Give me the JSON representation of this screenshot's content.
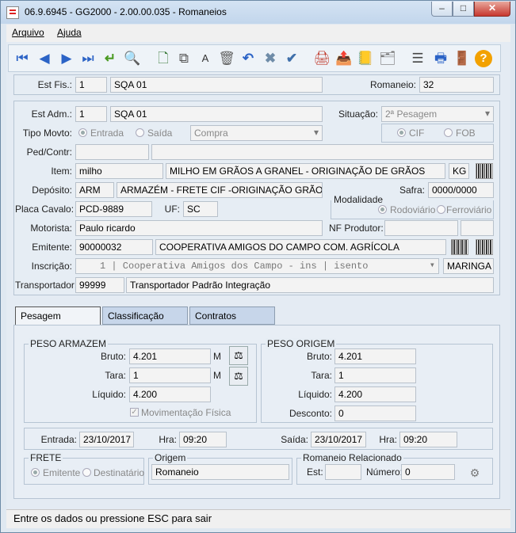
{
  "window": {
    "title": "06.9.6945 - GG2000 - 2.00.00.035 - Romaneios",
    "min": "–",
    "max": "□",
    "close": "✕"
  },
  "menu": {
    "arquivo": "Arquivo",
    "ajuda": "Ajuda"
  },
  "toolbar": {
    "icons": [
      "first-icon",
      "previous-icon",
      "next-icon",
      "last-icon",
      "confirm-icon",
      "search-icon",
      "new-icon",
      "copy-icon",
      "text-icon",
      "delete-icon",
      "undo-icon",
      "cancel-icon",
      "check-icon",
      "print-user-icon",
      "export-icon",
      "book-icon",
      "folder-x-icon",
      "tree-icon",
      "printer-icon",
      "exit-icon",
      "help-icon"
    ]
  },
  "header": {
    "est_fis_label": "Est Fis.:",
    "est_fis_code": "1",
    "est_fis_name": "SQA 01",
    "romaneio_label": "Romaneio:",
    "romaneio_value": "32"
  },
  "form": {
    "est_adm_label": "Est Adm.:",
    "est_adm_code": "1",
    "est_adm_name": "SQA 01",
    "situacao_label": "Situação:",
    "situacao_value": "2ª Pesagem",
    "tipo_movto_label": "Tipo Movto:",
    "entrada": "Entrada",
    "saida": "Saída",
    "tipo_value": "Compra",
    "cif": "CIF",
    "fob": "FOB",
    "ped_contr_label": "Ped/Contr:",
    "item_label": "Item:",
    "item_code": "milho",
    "item_desc": "MILHO EM GRÃOS A GRANEL - ORIGINAÇÃO DE GRÃOS",
    "item_unit": "KG",
    "deposito_label": "Depósito:",
    "deposito_code": "ARM",
    "deposito_desc": "ARMAZÉM - FRETE CIF -ORIGINAÇÃO GRÃOS",
    "safra_label": "Safra:",
    "safra_value": "0000/0000",
    "modalidade_label": "Modalidade",
    "rodoviario": "Rodoviário",
    "ferroviario": "Ferroviário",
    "placa_label": "Placa Cavalo:",
    "placa_value": "PCD-9889",
    "uf_label": "UF:",
    "uf_value": "SC",
    "motorista_label": "Motorista:",
    "motorista_value": "Paulo ricardo",
    "nf_produtor_label": "NF Produtor:",
    "emitente_label": "Emitente:",
    "emitente_code": "90000032",
    "emitente_name": "COOPERATIVA AMIGOS DO CAMPO COM. AGRÍCOLA",
    "inscricao_label": "Inscrição:",
    "inscricao_value": "1 | Cooperativa Amigos dos Campo - ins | isento",
    "inscricao_city": "MARINGA",
    "transportador_label": "Transportador:",
    "transportador_code": "99999",
    "transportador_name": "Transportador Padrão Integração"
  },
  "tabs": [
    "Pesagem",
    "Classificação",
    "Contratos"
  ],
  "pesagem": {
    "peso_armazem_caption": "PESO ARMAZEM",
    "bruto_label": "Bruto:",
    "bruto_value": "4.201",
    "bruto_unit": "M",
    "tara_label": "Tara:",
    "tara_value": "1",
    "tara_unit": "M",
    "liquido_label": "Líquido:",
    "liquido_value": "4.200",
    "movimentacao": "Movimentação Física",
    "peso_origem_caption": "PESO ORIGEM",
    "o_bruto_label": "Bruto:",
    "o_bruto_value": "4.201",
    "o_tara_label": "Tara:",
    "o_tara_value": "1",
    "o_liquido_label": "Líquido:",
    "o_liquido_value": "4.200",
    "desconto_label": "Desconto:",
    "desconto_value": "0"
  },
  "datas": {
    "entrada_label": "Entrada:",
    "entrada_data": "23/10/2017",
    "entrada_hra_label": "Hra:",
    "entrada_hra": "09:20",
    "saida_label": "Saída:",
    "saida_data": "23/10/2017",
    "saida_hra_label": "Hra:",
    "saida_hra": "09:20"
  },
  "frete": {
    "caption": "FRETE",
    "emitente": "Emitente",
    "destinatario": "Destinatário",
    "origem_caption": "Origem",
    "origem_value": "Romaneio",
    "romaneio_rel_caption": "Romaneio Relacionado",
    "est_label": "Est:",
    "numero_label": "Número:",
    "numero_value": "0"
  },
  "status": {
    "text": "Entre os dados ou pressione ESC para sair"
  }
}
